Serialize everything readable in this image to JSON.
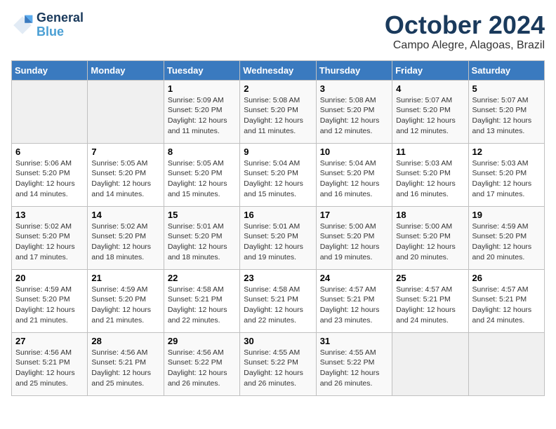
{
  "header": {
    "logo_line1": "General",
    "logo_line2": "Blue",
    "month_title": "October 2024",
    "location": "Campo Alegre, Alagoas, Brazil"
  },
  "days_of_week": [
    "Sunday",
    "Monday",
    "Tuesday",
    "Wednesday",
    "Thursday",
    "Friday",
    "Saturday"
  ],
  "weeks": [
    [
      {
        "day": "",
        "info": ""
      },
      {
        "day": "",
        "info": ""
      },
      {
        "day": "1",
        "info": "Sunrise: 5:09 AM\nSunset: 5:20 PM\nDaylight: 12 hours and 11 minutes."
      },
      {
        "day": "2",
        "info": "Sunrise: 5:08 AM\nSunset: 5:20 PM\nDaylight: 12 hours and 11 minutes."
      },
      {
        "day": "3",
        "info": "Sunrise: 5:08 AM\nSunset: 5:20 PM\nDaylight: 12 hours and 12 minutes."
      },
      {
        "day": "4",
        "info": "Sunrise: 5:07 AM\nSunset: 5:20 PM\nDaylight: 12 hours and 12 minutes."
      },
      {
        "day": "5",
        "info": "Sunrise: 5:07 AM\nSunset: 5:20 PM\nDaylight: 12 hours and 13 minutes."
      }
    ],
    [
      {
        "day": "6",
        "info": "Sunrise: 5:06 AM\nSunset: 5:20 PM\nDaylight: 12 hours and 14 minutes."
      },
      {
        "day": "7",
        "info": "Sunrise: 5:05 AM\nSunset: 5:20 PM\nDaylight: 12 hours and 14 minutes."
      },
      {
        "day": "8",
        "info": "Sunrise: 5:05 AM\nSunset: 5:20 PM\nDaylight: 12 hours and 15 minutes."
      },
      {
        "day": "9",
        "info": "Sunrise: 5:04 AM\nSunset: 5:20 PM\nDaylight: 12 hours and 15 minutes."
      },
      {
        "day": "10",
        "info": "Sunrise: 5:04 AM\nSunset: 5:20 PM\nDaylight: 12 hours and 16 minutes."
      },
      {
        "day": "11",
        "info": "Sunrise: 5:03 AM\nSunset: 5:20 PM\nDaylight: 12 hours and 16 minutes."
      },
      {
        "day": "12",
        "info": "Sunrise: 5:03 AM\nSunset: 5:20 PM\nDaylight: 12 hours and 17 minutes."
      }
    ],
    [
      {
        "day": "13",
        "info": "Sunrise: 5:02 AM\nSunset: 5:20 PM\nDaylight: 12 hours and 17 minutes."
      },
      {
        "day": "14",
        "info": "Sunrise: 5:02 AM\nSunset: 5:20 PM\nDaylight: 12 hours and 18 minutes."
      },
      {
        "day": "15",
        "info": "Sunrise: 5:01 AM\nSunset: 5:20 PM\nDaylight: 12 hours and 18 minutes."
      },
      {
        "day": "16",
        "info": "Sunrise: 5:01 AM\nSunset: 5:20 PM\nDaylight: 12 hours and 19 minutes."
      },
      {
        "day": "17",
        "info": "Sunrise: 5:00 AM\nSunset: 5:20 PM\nDaylight: 12 hours and 19 minutes."
      },
      {
        "day": "18",
        "info": "Sunrise: 5:00 AM\nSunset: 5:20 PM\nDaylight: 12 hours and 20 minutes."
      },
      {
        "day": "19",
        "info": "Sunrise: 4:59 AM\nSunset: 5:20 PM\nDaylight: 12 hours and 20 minutes."
      }
    ],
    [
      {
        "day": "20",
        "info": "Sunrise: 4:59 AM\nSunset: 5:20 PM\nDaylight: 12 hours and 21 minutes."
      },
      {
        "day": "21",
        "info": "Sunrise: 4:59 AM\nSunset: 5:20 PM\nDaylight: 12 hours and 21 minutes."
      },
      {
        "day": "22",
        "info": "Sunrise: 4:58 AM\nSunset: 5:21 PM\nDaylight: 12 hours and 22 minutes."
      },
      {
        "day": "23",
        "info": "Sunrise: 4:58 AM\nSunset: 5:21 PM\nDaylight: 12 hours and 22 minutes."
      },
      {
        "day": "24",
        "info": "Sunrise: 4:57 AM\nSunset: 5:21 PM\nDaylight: 12 hours and 23 minutes."
      },
      {
        "day": "25",
        "info": "Sunrise: 4:57 AM\nSunset: 5:21 PM\nDaylight: 12 hours and 24 minutes."
      },
      {
        "day": "26",
        "info": "Sunrise: 4:57 AM\nSunset: 5:21 PM\nDaylight: 12 hours and 24 minutes."
      }
    ],
    [
      {
        "day": "27",
        "info": "Sunrise: 4:56 AM\nSunset: 5:21 PM\nDaylight: 12 hours and 25 minutes."
      },
      {
        "day": "28",
        "info": "Sunrise: 4:56 AM\nSunset: 5:21 PM\nDaylight: 12 hours and 25 minutes."
      },
      {
        "day": "29",
        "info": "Sunrise: 4:56 AM\nSunset: 5:22 PM\nDaylight: 12 hours and 26 minutes."
      },
      {
        "day": "30",
        "info": "Sunrise: 4:55 AM\nSunset: 5:22 PM\nDaylight: 12 hours and 26 minutes."
      },
      {
        "day": "31",
        "info": "Sunrise: 4:55 AM\nSunset: 5:22 PM\nDaylight: 12 hours and 26 minutes."
      },
      {
        "day": "",
        "info": ""
      },
      {
        "day": "",
        "info": ""
      }
    ]
  ]
}
